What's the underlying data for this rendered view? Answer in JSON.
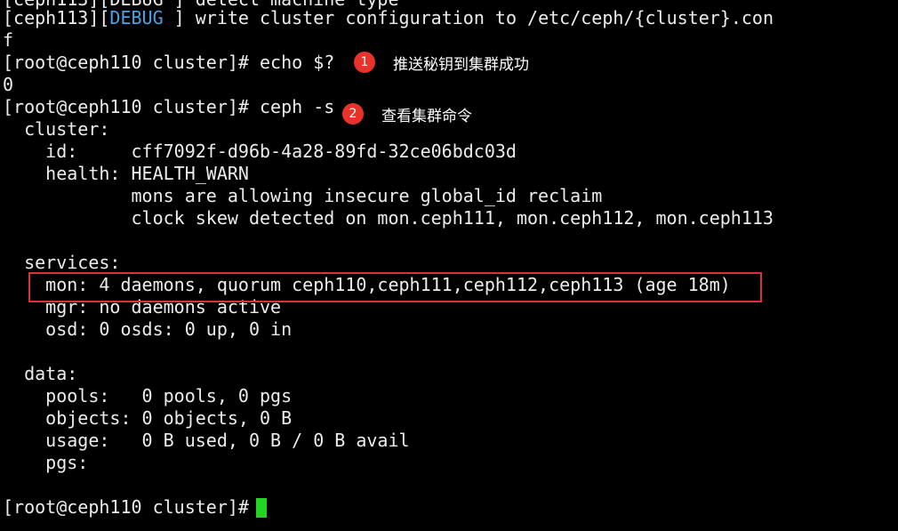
{
  "terminal": {
    "partial_top": "[ceph113][DEBUG ] detect machine type",
    "debug_line": {
      "pre": "[ceph113][",
      "tag": "DEBUG",
      "post": " ] write cluster configuration to /etc/ceph/{cluster}.con"
    },
    "wrap_f": "f",
    "cmd_echo": "[root@ceph110 cluster]# echo $?",
    "echo_result": "0",
    "cmd_ceph": "[root@ceph110 cluster]# ceph -s",
    "cluster_header": "  cluster:",
    "cluster_id": "    id:     cff7092f-d96b-4a28-89fd-32ce06bdc03d",
    "cluster_health": "    health: HEALTH_WARN",
    "health_msg1": "            mons are allowing insecure global_id reclaim",
    "health_msg2": "            clock skew detected on mon.ceph111, mon.ceph112, mon.ceph113",
    "services_header": "  services:",
    "svc_mon": "    mon: 4 daemons, quorum ceph110,ceph111,ceph112,ceph113 (age 18m)",
    "svc_mgr": "    mgr: no daemons active",
    "svc_osd": "    osd: 0 osds: 0 up, 0 in",
    "data_header": "  data:",
    "data_pools": "    pools:   0 pools, 0 pgs",
    "data_objects": "    objects: 0 objects, 0 B",
    "data_usage": "    usage:   0 B used, 0 B / 0 B avail",
    "data_pgs": "    pgs:",
    "prompt_final": "[root@ceph110 cluster]# "
  },
  "annotations": [
    {
      "number": "1",
      "text": "推送秘钥到集群成功"
    },
    {
      "number": "2",
      "text": "查看集群命令"
    }
  ],
  "colors": {
    "background": "#000000",
    "text": "#ececec",
    "debug_tag": "#4aa3e8",
    "badge": "#e8322a",
    "highlight_border": "#d9333a",
    "cursor": "#22d424"
  }
}
